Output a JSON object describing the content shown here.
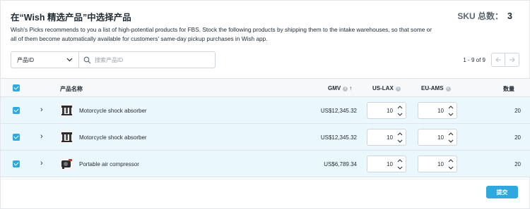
{
  "header": {
    "title": "在“Wish 精选产品”中选择产品",
    "sku_label": "SKU 总数：",
    "sku_count": "3",
    "description": "Wish's Picks recommends to you a list of high-potential products for FBS. Stock the following products by shipping them to the intake warehouses, so that some or all of them become automatically available for customers' same-day pickup purchases in Wish app."
  },
  "filter": {
    "select_value": "产品ID",
    "search_placeholder": "搜索产品ID"
  },
  "pager": {
    "count": "1 - 9 of 9"
  },
  "table": {
    "columns": {
      "name": "产品名称",
      "gmv": "GMV",
      "us_lax": "US-LAX",
      "eu_ams": "EU-AMS",
      "amount": "数量"
    },
    "rows": [
      {
        "name": "Motorcycle shock absorber",
        "gmv": "US$12,345.32",
        "us_lax": "10",
        "eu_ams": "10",
        "amount": "20",
        "thumb": "shock-absorber"
      },
      {
        "name": "Motorcycle shock absorber",
        "gmv": "US$12,345.32",
        "us_lax": "10",
        "eu_ams": "10",
        "amount": "20",
        "thumb": "shock-absorber"
      },
      {
        "name": "Portable air compressor",
        "gmv": "US$6,789.34",
        "us_lax": "10",
        "eu_ams": "10",
        "amount": "20",
        "thumb": "air-compressor"
      }
    ]
  },
  "footer": {
    "submit_label": "提交"
  },
  "colors": {
    "accent": "#2fa8dd",
    "row_selected": "#eaf7fc"
  }
}
